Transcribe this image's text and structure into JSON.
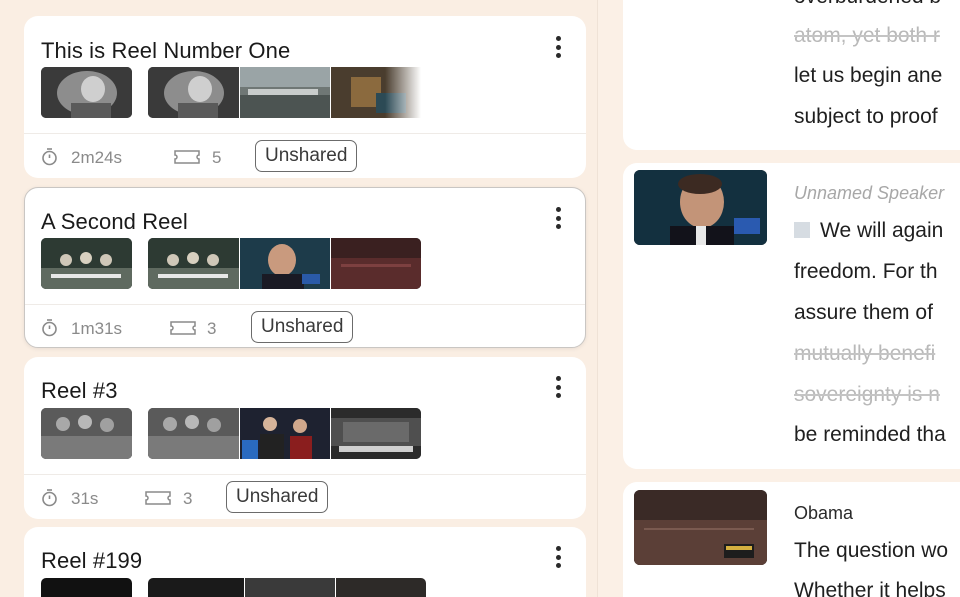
{
  "reels": [
    {
      "title": "This is Reel Number One",
      "duration": "2m24s",
      "clip_count": "5",
      "share_status": "Unshared"
    },
    {
      "title": "A Second Reel",
      "duration": "1m31s",
      "clip_count": "3",
      "share_status": "Unshared"
    },
    {
      "title": "Reel #3",
      "duration": "31s",
      "clip_count": "3",
      "share_status": "Unshared"
    },
    {
      "title": "Reel #199"
    }
  ],
  "transcript": {
    "card1": {
      "lines": [
        {
          "text": "overburdened b",
          "struck": false
        },
        {
          "text": "atom, yet both r",
          "struck": true
        },
        {
          "text": "let us begin ane",
          "struck": false
        },
        {
          "text": "subject to proof",
          "struck": false
        }
      ]
    },
    "card2": {
      "speaker": "Unnamed Speaker",
      "lines": [
        {
          "text": "We will again",
          "struck": false
        },
        {
          "text": "freedom. For th",
          "struck": false
        },
        {
          "text": "assure them of",
          "struck": false
        },
        {
          "text": "mutually benefi",
          "struck": true
        },
        {
          "text": "sovereignty is n",
          "struck": true
        },
        {
          "text": "be reminded tha",
          "struck": false
        }
      ]
    },
    "card3": {
      "speaker": "Obama",
      "lines": [
        {
          "text": "The question wo",
          "struck": false
        },
        {
          "text": "Whether it helps",
          "struck": false
        }
      ]
    }
  },
  "colors": {
    "page_bg": "#fbf0e6",
    "card_bg": "#ffffff",
    "badge_border": "#6b6b6b",
    "strike_text": "#b9b9b9",
    "muted_text": "#8a8a8a"
  },
  "icons": {
    "kebab": "more-vertical-icon",
    "duration": "stopwatch-icon",
    "clips": "film-strip-icon",
    "square": "speaker-square-icon"
  }
}
